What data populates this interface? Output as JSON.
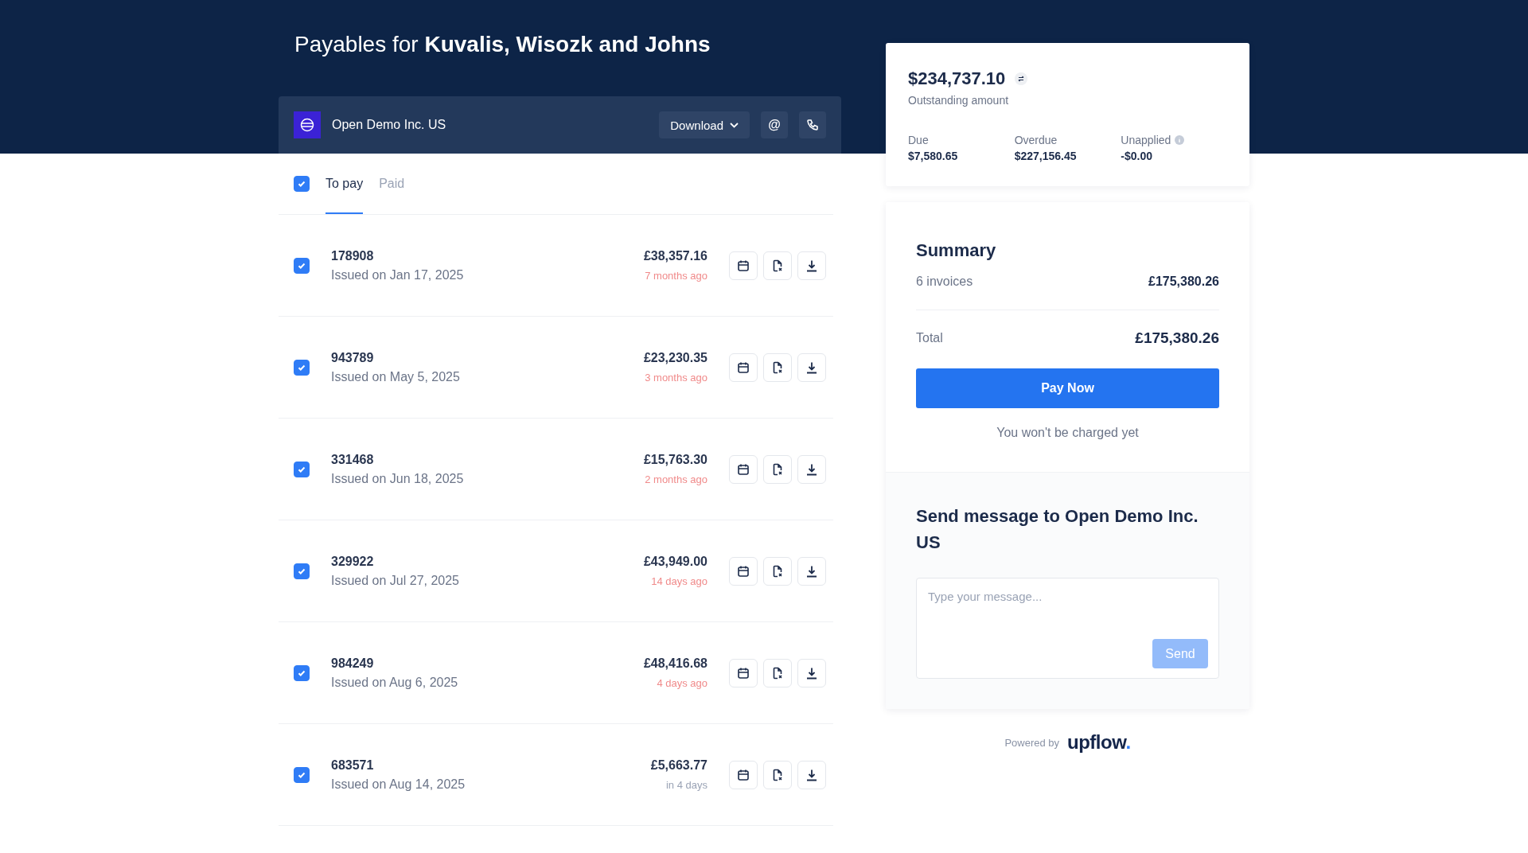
{
  "title": {
    "prefix": "Payables for ",
    "customer": "Kuvalis, Wisozk and Johns"
  },
  "company": {
    "name": "Open Demo Inc. US",
    "download": "Download",
    "email_button": "@"
  },
  "tabs": [
    {
      "label": "To pay",
      "selected": true
    },
    {
      "label": "Paid",
      "selected": false
    }
  ],
  "select_all": {
    "checked": true
  },
  "invoices": [
    {
      "number": "178908",
      "issued": "Issued on Jan 17, 2025",
      "amount": "£38,357.16",
      "due": "7 months ago",
      "overdue": true,
      "checked": true
    },
    {
      "number": "943789",
      "issued": "Issued on May 5, 2025",
      "amount": "£23,230.35",
      "due": "3 months ago",
      "overdue": true,
      "checked": true
    },
    {
      "number": "331468",
      "issued": "Issued on Jun 18, 2025",
      "amount": "£15,763.30",
      "due": "2 months ago",
      "overdue": true,
      "checked": true
    },
    {
      "number": "329922",
      "issued": "Issued on Jul 27, 2025",
      "amount": "£43,949.00",
      "due": "14 days ago",
      "overdue": true,
      "checked": true
    },
    {
      "number": "984249",
      "issued": "Issued on Aug 6, 2025",
      "amount": "£48,416.68",
      "due": "4 days ago",
      "overdue": true,
      "checked": true
    },
    {
      "number": "683571",
      "issued": "Issued on Aug 14, 2025",
      "amount": "£5,663.77",
      "due": "in 4 days",
      "overdue": false,
      "checked": true
    }
  ],
  "balance": {
    "amount": "$234,737.10",
    "label": "Outstanding amount",
    "stats": [
      {
        "kind": "plain",
        "label": "Due",
        "value": "$7,580.65"
      },
      {
        "kind": "plain",
        "label": "Overdue",
        "value": "$227,156.45"
      },
      {
        "kind": "info",
        "label": "Unapplied",
        "value": "-$0.00"
      }
    ]
  },
  "summary": {
    "title": "Summary",
    "count": "6 invoices",
    "count_amount": "£175,380.26",
    "total_label": "Total",
    "total": "£175,380.26",
    "pay_button": "Pay Now",
    "note": "You won't be charged yet"
  },
  "message": {
    "title": "Send message to Open Demo Inc. US",
    "placeholder": "Type your message...",
    "send": "Send",
    "send_disabled": true
  },
  "footer": {
    "powered": "Powered by",
    "brand": "upflow",
    "brand_dot": "."
  }
}
